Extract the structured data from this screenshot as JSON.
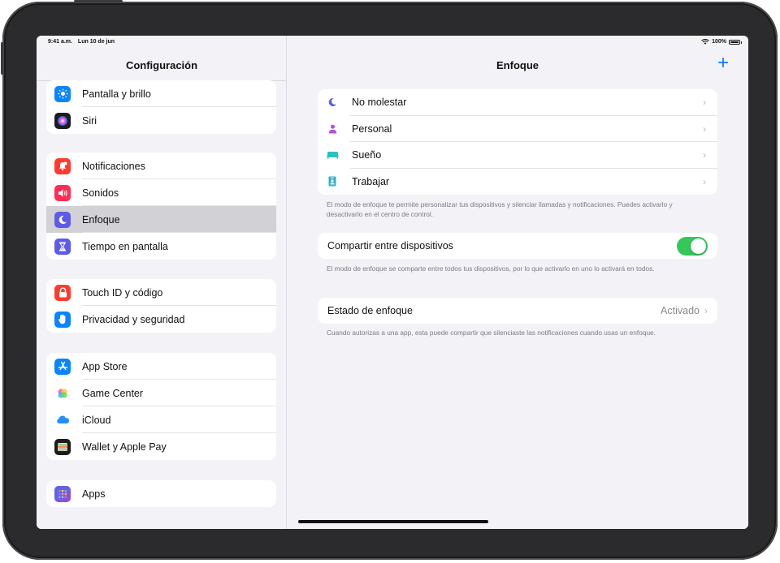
{
  "status_bar": {
    "time": "9:41 a.m.",
    "date": "Lun 10 de jun",
    "battery": "100%",
    "wifi_icon": "wifi-icon"
  },
  "sidebar": {
    "title": "Configuración",
    "groups": [
      {
        "items": [
          {
            "label": "Pantalla y brillo",
            "icon": "sun-icon",
            "color": "#0a84ff"
          },
          {
            "label": "Siri",
            "icon": "siri-icon",
            "color": "#1c1c1e"
          }
        ]
      },
      {
        "items": [
          {
            "label": "Notificaciones",
            "icon": "bell-icon",
            "color": "#ff3b30"
          },
          {
            "label": "Sonidos",
            "icon": "speaker-icon",
            "color": "#ff2d55"
          },
          {
            "label": "Enfoque",
            "icon": "moon-icon",
            "color": "#5e5ce6",
            "selected": true
          },
          {
            "label": "Tiempo en pantalla",
            "icon": "hourglass-icon",
            "color": "#5e5ce6"
          }
        ]
      },
      {
        "items": [
          {
            "label": "Touch ID y código",
            "icon": "lock-icon",
            "color": "#ff3b30"
          },
          {
            "label": "Privacidad y seguridad",
            "icon": "hand-icon",
            "color": "#0a84ff"
          }
        ]
      },
      {
        "items": [
          {
            "label": "App Store",
            "icon": "app-store-icon",
            "color": "#0a84ff"
          },
          {
            "label": "Game Center",
            "icon": "game-center-icon",
            "color": "#ffffff"
          },
          {
            "label": "iCloud",
            "icon": "cloud-icon",
            "color": "#ffffff"
          },
          {
            "label": "Wallet y Apple Pay",
            "icon": "wallet-icon",
            "color": "#1c1c1e"
          }
        ]
      },
      {
        "items": [
          {
            "label": "Apps",
            "icon": "apps-grid-icon",
            "color": "#6e4cd6"
          }
        ]
      }
    ]
  },
  "detail": {
    "title": "Enfoque",
    "add_symbol": "+",
    "focus_modes": [
      {
        "label": "No molestar",
        "icon": "moon-icon",
        "color": "#5e5ce6",
        "glyph": "☾"
      },
      {
        "label": "Personal",
        "icon": "person-icon",
        "color": "#af52de",
        "glyph": "●"
      },
      {
        "label": "Sueño",
        "icon": "bed-icon",
        "color": "#30c0c0",
        "glyph": "▬"
      },
      {
        "label": "Trabajar",
        "icon": "badge-icon",
        "color": "#30b0c7",
        "glyph": "▮"
      }
    ],
    "focus_note": "El modo de enfoque te permite personalizar tus dispositivos y silenciar llamadas y notificaciones. Puedes activarlo y desactivarlo en el centro de control.",
    "share_label": "Compartir entre dispositivos",
    "share_enabled": true,
    "share_note": "El modo de enfoque se comparte entre todos tus dispositivos, por lo que activarlo en uno lo activará en todos.",
    "status_label": "Estado de enfoque",
    "status_value": "Activado",
    "status_note": "Cuando autorizas a una app, esta puede compartir que silenciaste las notificaciones cuando usas un enfoque.",
    "chevron": "›"
  }
}
